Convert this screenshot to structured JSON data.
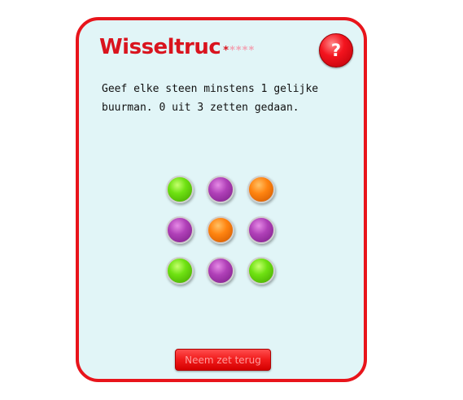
{
  "game": {
    "title": "Wisseltruc",
    "stars_filled": "*",
    "stars_empty": "****",
    "help_label": "?",
    "instructions": "Geef elke steen minstens 1 gelijke buurman. 0 uit 3 zetten gedaan.",
    "undo_label": "Neem zet terug"
  },
  "board": {
    "rows": 3,
    "cols": 3,
    "stones": [
      [
        "green",
        "purple",
        "orange"
      ],
      [
        "purple",
        "orange",
        "purple"
      ],
      [
        "green",
        "purple",
        "green"
      ]
    ]
  },
  "colors": {
    "accent": "#e8141b",
    "panel_background": "#e1f5f7",
    "green": "#6fe212",
    "purple": "#b040b8",
    "orange": "#ff8410"
  }
}
